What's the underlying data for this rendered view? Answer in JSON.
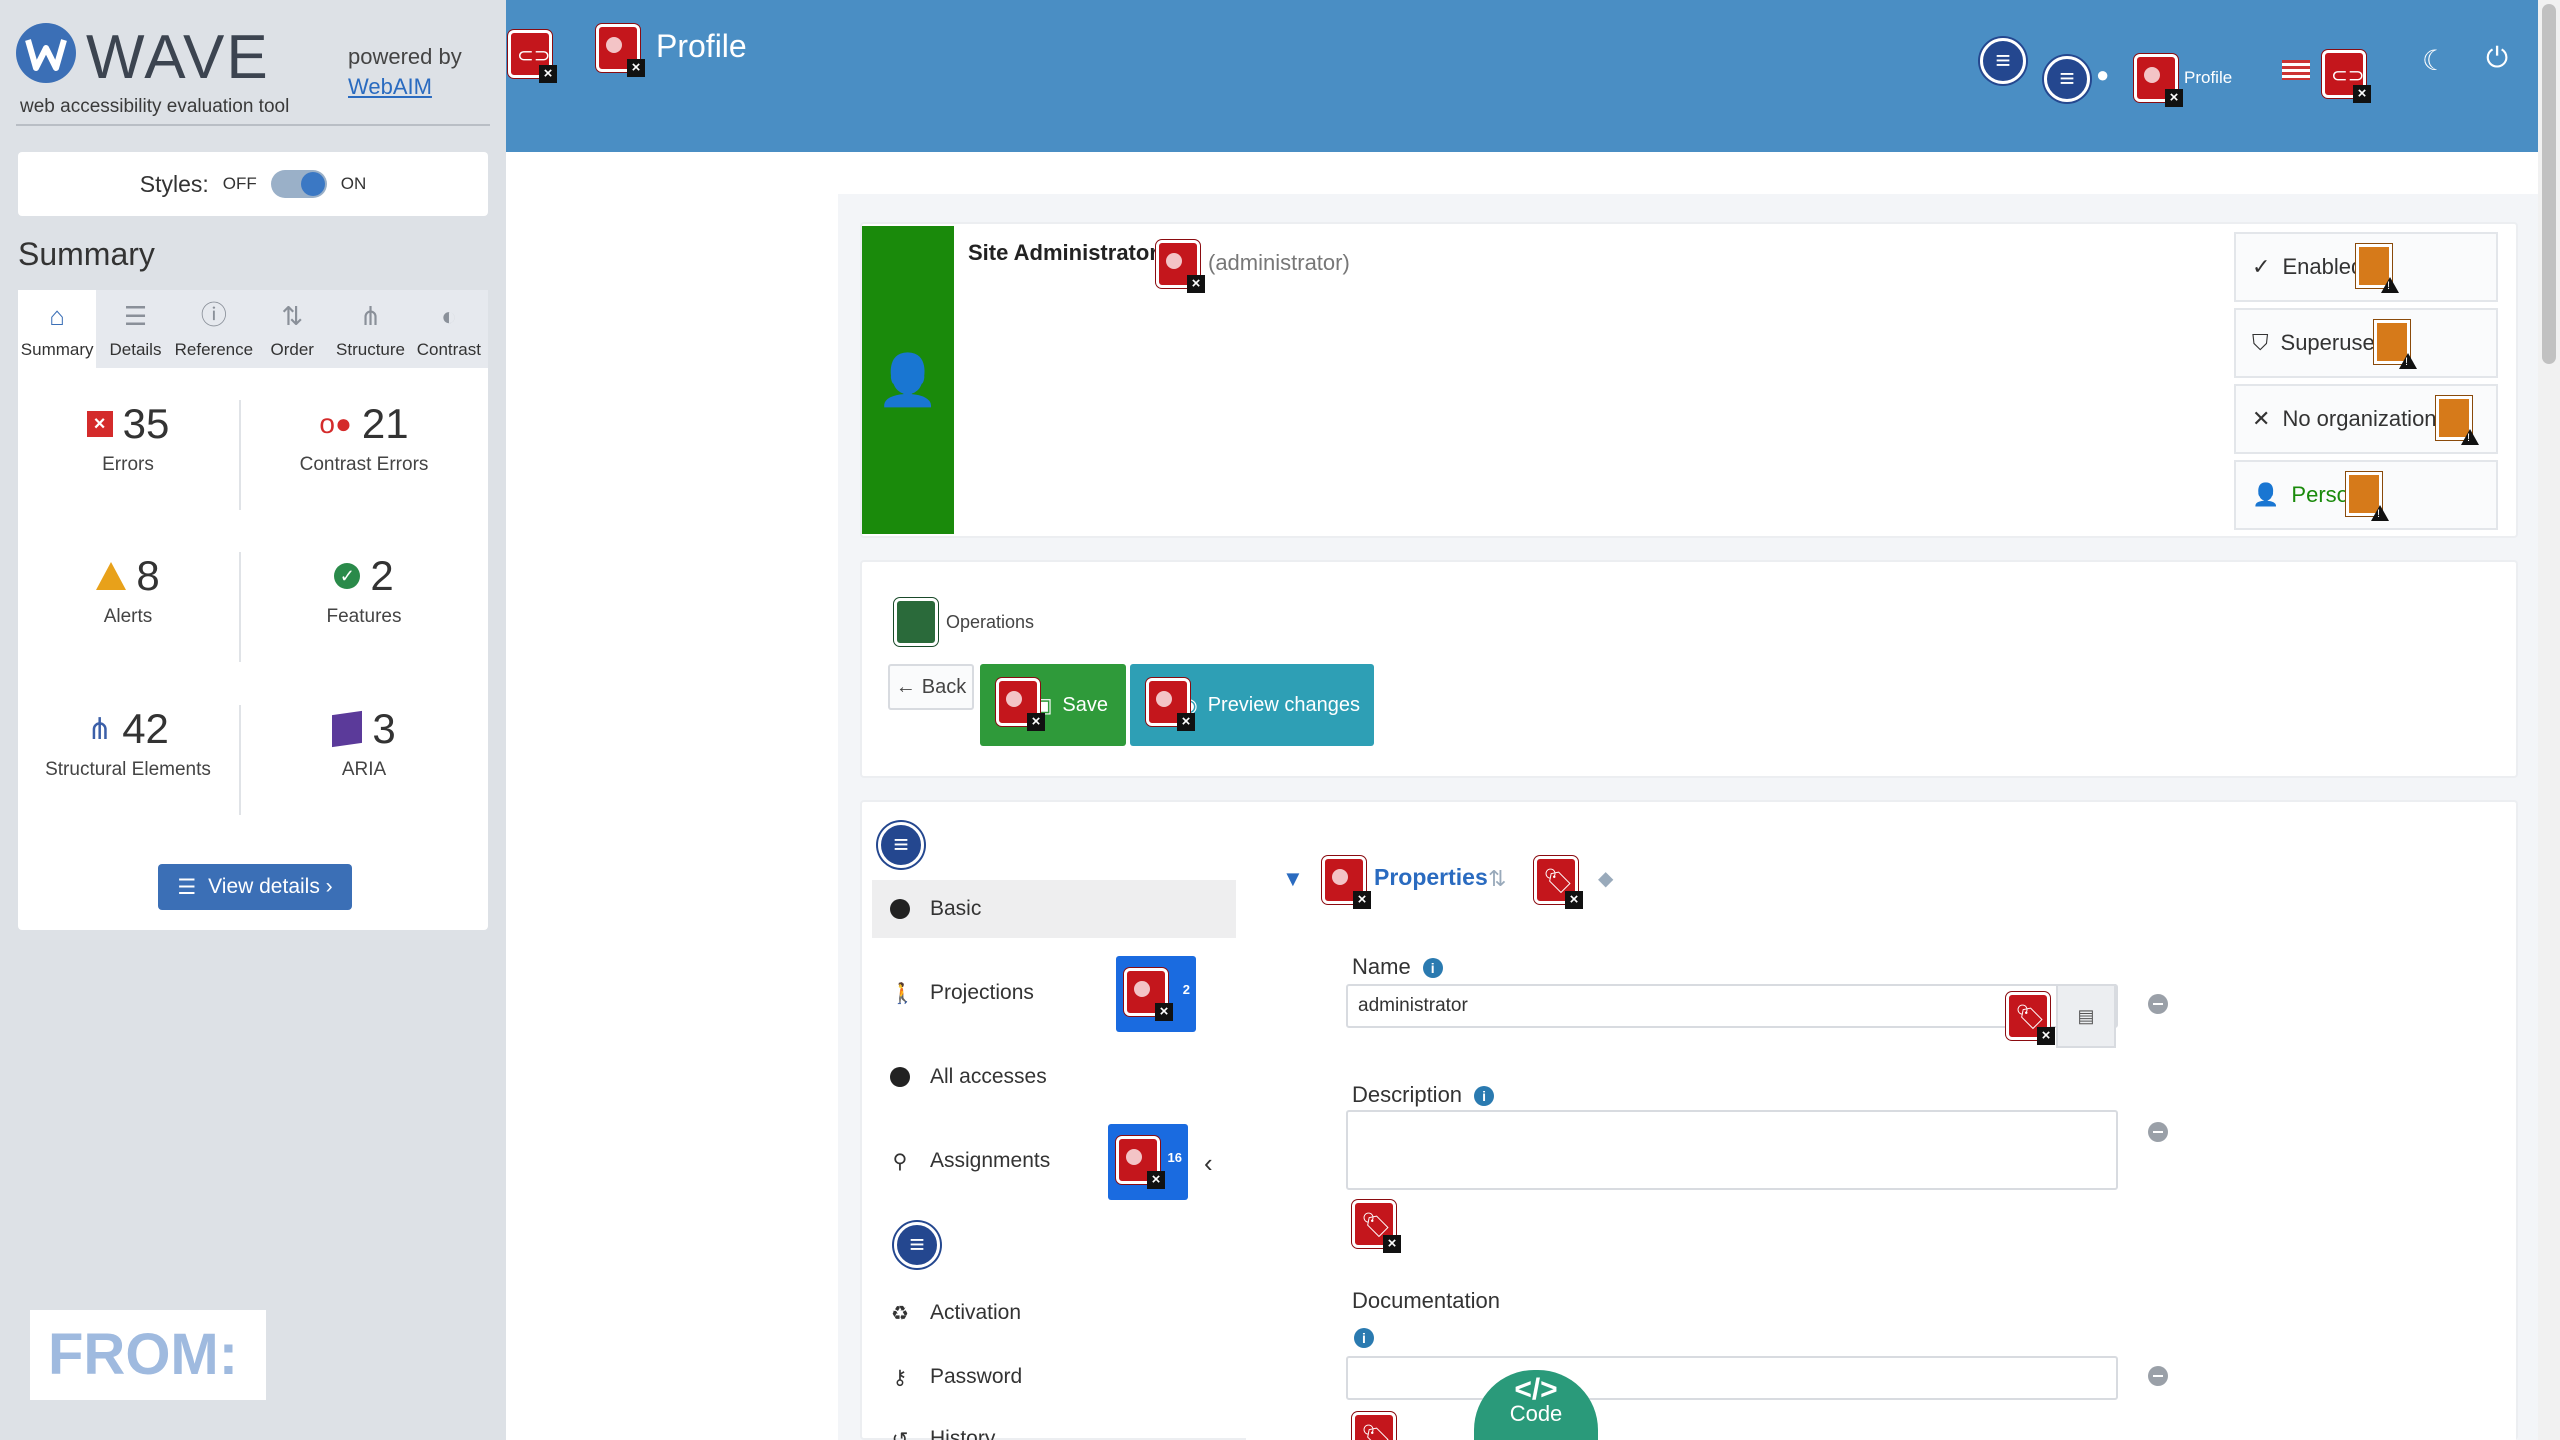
{
  "wave": {
    "title": "WAVE",
    "subtitle": "web accessibility evaluation tool",
    "powered_by": "powered by",
    "powered_link": "WebAIM",
    "styles_label": "Styles:",
    "styles_off": "OFF",
    "styles_on": "ON",
    "summary_heading": "Summary",
    "tabs": [
      {
        "label": "Summary",
        "icon": "home-icon"
      },
      {
        "label": "Details",
        "icon": "list-icon"
      },
      {
        "label": "Reference",
        "icon": "info-icon"
      },
      {
        "label": "Order",
        "icon": "order-icon"
      },
      {
        "label": "Structure",
        "icon": "structure-icon"
      },
      {
        "label": "Contrast",
        "icon": "contrast-icon"
      }
    ],
    "stats": {
      "errors": {
        "value": "35",
        "label": "Errors"
      },
      "contrast": {
        "value": "21",
        "label": "Contrast Errors"
      },
      "alerts": {
        "value": "8",
        "label": "Alerts"
      },
      "features": {
        "value": "2",
        "label": "Features"
      },
      "structural": {
        "value": "42",
        "label": "Structural Elements"
      },
      "aria": {
        "value": "3",
        "label": "ARIA"
      }
    },
    "view_details": "View details ›",
    "from_label": "FROM:"
  },
  "header": {
    "title": "Profile",
    "profile_label": "Profile"
  },
  "user": {
    "name": "Site Administrator",
    "login": "(administrator)",
    "badges": [
      {
        "label": "Enabled",
        "icon": "check-icon"
      },
      {
        "label": "Superuser",
        "icon": "shield-icon"
      },
      {
        "label": "No organizations",
        "icon": "x-icon"
      },
      {
        "label": "Person",
        "icon": "person-icon"
      }
    ]
  },
  "operations": {
    "title": "Operations",
    "back": "Back",
    "save": "Save",
    "preview": "Preview changes"
  },
  "nav": {
    "items": [
      {
        "label": "Basic",
        "icon": "circle-icon"
      },
      {
        "label": "Projections",
        "icon": "person-standing-icon",
        "count": "2"
      },
      {
        "label": "All accesses",
        "icon": "circle-icon"
      },
      {
        "label": "Assignments",
        "icon": "assign-icon",
        "count": "16"
      },
      {
        "label": "Activation",
        "icon": "recycle-icon"
      },
      {
        "label": "Password",
        "icon": "key-icon"
      },
      {
        "label": "History",
        "icon": "history-icon"
      }
    ]
  },
  "form": {
    "section": "Properties",
    "name_label": "Name",
    "name_value": "administrator",
    "description_label": "Description",
    "description_value": "",
    "documentation_label": "Documentation",
    "documentation_value": ""
  },
  "code_tab": {
    "glyph": "</>",
    "label": "Code"
  },
  "colors": {
    "header_bg": "#4a8ec4",
    "avatar_bg": "#1a8a0b",
    "save_bg": "#2f9a3a",
    "preview_bg": "#2e9fb5",
    "wave_error": "#c4161c"
  }
}
